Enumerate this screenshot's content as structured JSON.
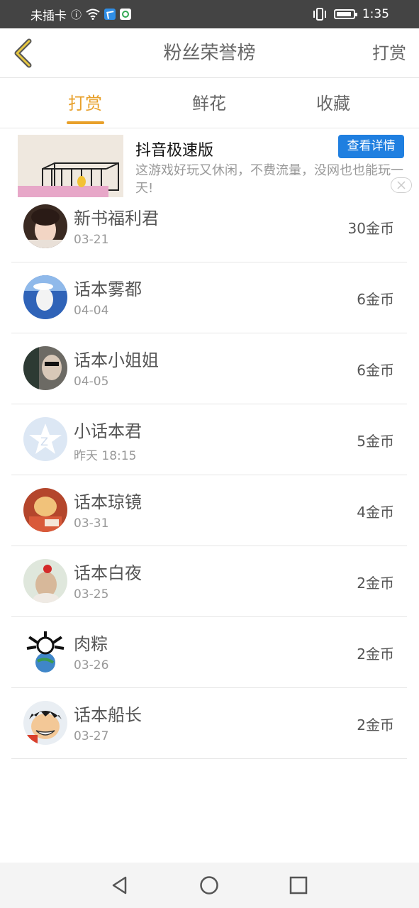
{
  "status_bar": {
    "carrier": "未插卡",
    "time": "1:35"
  },
  "header": {
    "back_icon": "chevron-left-icon",
    "title": "粉丝荣誉榜",
    "right_action": "打赏"
  },
  "tabs": [
    {
      "label": "打赏",
      "active": true
    },
    {
      "label": "鲜花",
      "active": false
    },
    {
      "label": "收藏",
      "active": false
    }
  ],
  "ad": {
    "title": "抖音极速版",
    "description": "这游戏好玩又休闲，不费流量，没网也也能玩一天!",
    "button": "查看详情",
    "close_icon": "close-icon"
  },
  "list": [
    {
      "name": "新书福利君",
      "date": "03-21",
      "amount": "30金币"
    },
    {
      "name": "话本雾都",
      "date": "04-04",
      "amount": "6金币"
    },
    {
      "name": "话本小姐姐",
      "date": "04-05",
      "amount": "6金币"
    },
    {
      "name": "小话本君",
      "date": "昨天 18:15",
      "amount": "5金币"
    },
    {
      "name": "话本琼镜",
      "date": "03-31",
      "amount": "4金币"
    },
    {
      "name": "话本白夜",
      "date": "03-25",
      "amount": "2金币"
    },
    {
      "name": "肉粽",
      "date": "03-26",
      "amount": "2金币"
    },
    {
      "name": "话本船长",
      "date": "03-27",
      "amount": "2金币"
    }
  ],
  "colors": {
    "accent": "#e8a02a",
    "ad_button": "#1f7fe0",
    "status_bar": "#444444"
  },
  "nav": {
    "back_icon": "triangle-back-icon",
    "home_icon": "circle-home-icon",
    "recents_icon": "square-recents-icon"
  }
}
